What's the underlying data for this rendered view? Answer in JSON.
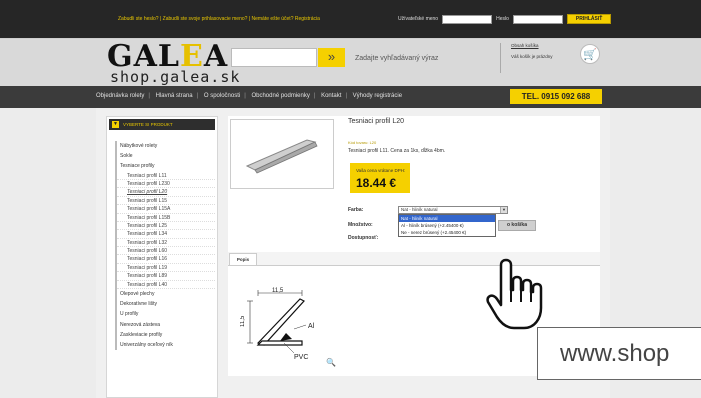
{
  "topbar": {
    "links": "Zabudli ste heslo? | Zabudli ste svoje prihlasovacie meno? | Nemáte ešte účet? Registrácia",
    "username_label": "Užívateľské meno",
    "password_label": "Heslo",
    "login_button": "PRIHLÁSIŤ"
  },
  "header": {
    "logo_main": "GALEA",
    "logo_sub": "shop.galea.sk",
    "search_button": "»",
    "search_hint": "Zadajte vyhľadávaný výraz",
    "cart_title": "Obsah košíka",
    "cart_status": "Váš košík je prázdny"
  },
  "nav": {
    "items": [
      "Objednávka rolety",
      "Hlavná strana",
      "O spoločnosti",
      "Obchodné podmienky",
      "Kontakt",
      "Výhody registrácie"
    ],
    "phone": "TEL. 0915 092 688"
  },
  "sidebar": {
    "heading": "VYBERTE SI PRODUKT",
    "items": [
      {
        "label": "Nábytkové rolety",
        "type": "cat"
      },
      {
        "label": "Sokle",
        "type": "cat"
      },
      {
        "label": "Tesniace profily",
        "type": "cat"
      },
      {
        "label": "Tesniaci profil L11",
        "type": "sub"
      },
      {
        "label": "Tesniaci profil L230",
        "type": "sub"
      },
      {
        "label": "Tesniaci profil L20",
        "type": "active"
      },
      {
        "label": "Tesniaci profil L15",
        "type": "sub"
      },
      {
        "label": "Tesniaci profil L15A",
        "type": "sub"
      },
      {
        "label": "Tesniaci profil L15B",
        "type": "sub"
      },
      {
        "label": "Tesniaci profil L25",
        "type": "sub"
      },
      {
        "label": "Tesniaci profil L34",
        "type": "sub"
      },
      {
        "label": "Tesniaci profil L32",
        "type": "sub"
      },
      {
        "label": "Tesniaci profil L60",
        "type": "sub"
      },
      {
        "label": "Tesniaci profil L16",
        "type": "sub"
      },
      {
        "label": "Tesniaci profil L19",
        "type": "sub"
      },
      {
        "label": "Tesniaci profil L89",
        "type": "sub"
      },
      {
        "label": "Tesniaci profil L40",
        "type": "sub"
      },
      {
        "label": "Olepové plechy",
        "type": "cat"
      },
      {
        "label": "Dekoratívne lišty",
        "type": "cat"
      },
      {
        "label": "U profily",
        "type": "cat"
      },
      {
        "label": "Nerezová zásteva",
        "type": "cat"
      },
      {
        "label": "Zaskleviacie profily",
        "type": "cat"
      },
      {
        "label": "Univerzálny oceľový ník",
        "type": "cat"
      }
    ]
  },
  "product": {
    "title": "Tesniaci profil L20",
    "code": "Kód tovaru: L20",
    "description": "Tesniaci profil L11. Cena za 1ks, dĺžka 4bm.",
    "price_label": "Vaša cena vrátane DPH:",
    "price": "18.44 €",
    "color_label": "Farba:",
    "quantity_label": "Množstvo:",
    "availability_label": "Dostupnosť:",
    "color_selected": "Nat - hliník natural",
    "color_options": [
      "Nat - hliník natural",
      "Al - hliník brúsený (+2.45400 €)",
      "Ne - nerez brúsený (+2.45400 €)"
    ],
    "cart_button": "o košíka"
  },
  "tabs": {
    "description_tab": "Popis"
  },
  "drawing": {
    "dim_width": "11,5",
    "dim_height": "11,5",
    "label_al": "Al",
    "label_pvc": "PVC"
  },
  "watermark": "www.shop"
}
